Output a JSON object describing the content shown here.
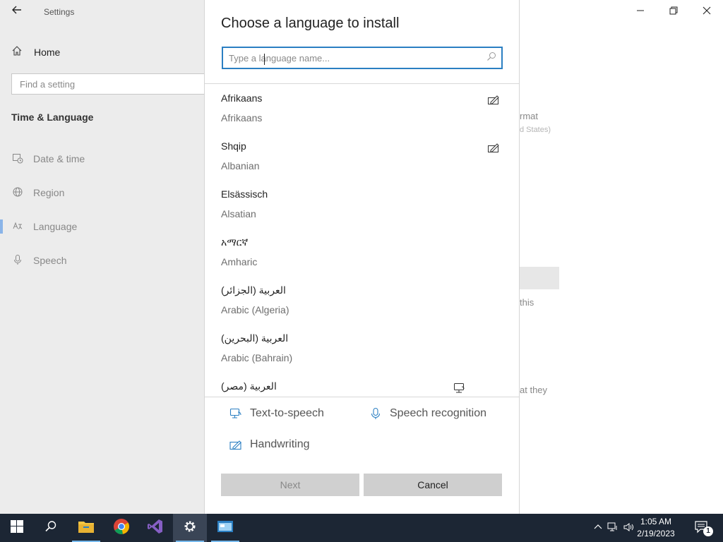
{
  "settings": {
    "window_title": "Settings",
    "home_label": "Home",
    "search_placeholder": "Find a setting",
    "section_title": "Time & Language",
    "nav_items": [
      {
        "label": "Date & time",
        "icon": "calendar-clock-icon"
      },
      {
        "label": "Region",
        "icon": "globe-icon"
      },
      {
        "label": "Language",
        "icon": "language-icon",
        "selected": true
      },
      {
        "label": "Speech",
        "icon": "microphone-icon"
      }
    ],
    "background_fragments": {
      "format": "rmat",
      "region_value": "d States)",
      "this": "this",
      "that_they": "at they"
    }
  },
  "dialog": {
    "title": "Choose a language to install",
    "search_placeholder": "Type a language name...",
    "languages": [
      {
        "native": "Afrikaans",
        "english": "Afrikaans",
        "feature_icon": "handwriting-icon"
      },
      {
        "native": "Shqip",
        "english": "Albanian",
        "feature_icon": "handwriting-icon"
      },
      {
        "native": "Elsässisch",
        "english": "Alsatian",
        "feature_icon": ""
      },
      {
        "native": "አማርኛ",
        "english": "Amharic",
        "feature_icon": ""
      },
      {
        "native": "العربية (الجزائر)",
        "english": "Arabic (Algeria)",
        "feature_icon": ""
      },
      {
        "native": "العربية (البحرين)",
        "english": "Arabic (Bahrain)",
        "feature_icon": ""
      },
      {
        "native": "العربية (مصر)",
        "english": "",
        "feature_icon": "text-to-speech-icon"
      }
    ],
    "legend": {
      "tts": "Text-to-speech",
      "speech": "Speech recognition",
      "handwriting": "Handwriting"
    },
    "buttons": {
      "next": "Next",
      "cancel": "Cancel"
    }
  },
  "taskbar": {
    "time": "1:05 AM",
    "date": "2/19/2023",
    "notification_count": "1"
  },
  "colors": {
    "accent": "#2b7fc2",
    "taskbar_bg": "#1c2634"
  }
}
